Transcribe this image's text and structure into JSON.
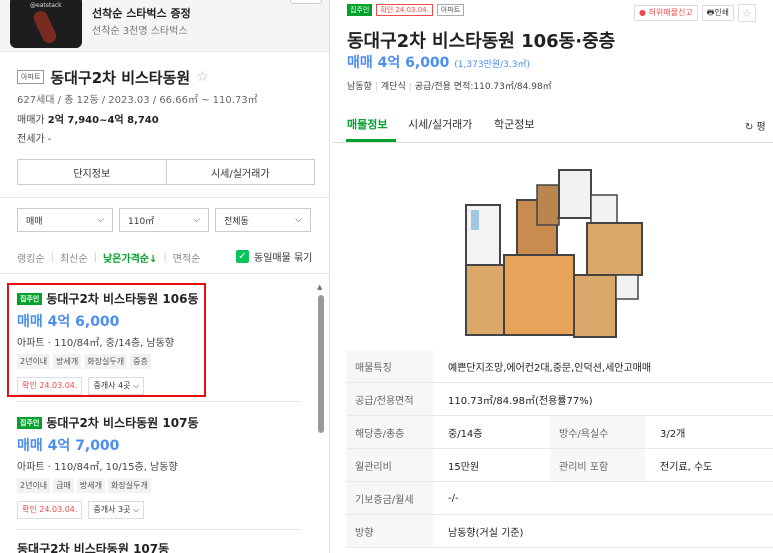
{
  "ad": {
    "thumb_brand": "@eatstack",
    "title": "선착순 스타벅스 증정",
    "subtitle": "선착순 3천명 스타벅스"
  },
  "complex": {
    "type_badge": "아파트",
    "name": "동대구2차 비스타동원",
    "star": "☆",
    "meta": "627세대 / 총 12동 / 2023.03 / 66.66㎡ ~ 110.73㎡",
    "sale_label": "매매가",
    "sale_value": "2억 7,940~4억 8,740",
    "rent_label": "전세가 -",
    "btn_complex_info": "단지정보",
    "btn_market_price": "시세/실거래가"
  },
  "filters": {
    "trade": "매매",
    "size": "110㎡",
    "dong": "전체동"
  },
  "sort": {
    "items": [
      "랭킹순",
      "최신순",
      "낮은가격순↓",
      "면적순"
    ],
    "active_index": 2,
    "same_listing_label": "동일매물 묶기"
  },
  "listings": [
    {
      "tag": "집주인",
      "title": "동대구2차 비스타동원 106동",
      "price": "매매 4억 6,000",
      "info": "아파트 · 110/84㎡, 중/14층, 남동향",
      "chips": [
        "2년이내",
        "방세개",
        "화장실두개",
        "중층"
      ],
      "confirm": "확인 24.03.04.",
      "agent": "중개사 4곳 ⌵"
    },
    {
      "tag": "집주인",
      "title": "동대구2차 비스타동원 107동",
      "price": "매매 4억 7,000",
      "info": "아파트 · 110/84㎡, 10/15층, 남동향",
      "chips": [
        "2년이내",
        "급매",
        "방세개",
        "화장실두개"
      ],
      "confirm": "확인 24.03.04.",
      "agent": "중개사 3곳 ⌵"
    },
    {
      "title": "동대구2차 비스타동원 107동"
    }
  ],
  "detail": {
    "tag_owner": "집주인",
    "tag_confirm": "확인 24.03.04.",
    "tag_type": "아파트",
    "report": "● 허위매물신고",
    "print": "🖶인쇄",
    "star": "☆",
    "title": "동대구2차 비스타동원 106동·중층",
    "price": "매매 4억 6,000",
    "price_unit": "(1,373만원/3.3㎡)",
    "spec": [
      "남동향",
      "계단식",
      "공급/전용 면적:110.73㎡/84.98㎡"
    ],
    "tabs": [
      "매물정보",
      "시세/실거래가",
      "학군정보"
    ],
    "refresh": "↻ 평",
    "table": [
      {
        "k": "매물특징",
        "v": "예쁜단지조망,에어컨2대,중문,인덕션,세안고매매"
      },
      {
        "k": "공급/전용면적",
        "v": "110.73㎡/84.98㎡(전용률77%)"
      },
      {
        "k": "해당층/총층",
        "v": "중/14층",
        "k2": "방수/욕실수",
        "v2": "3/2개"
      },
      {
        "k": "월관리비",
        "v": "15만원",
        "k2": "관리비 포함",
        "v2": "전기료, 수도"
      },
      {
        "k": "기보증금/월세",
        "v": "-/-"
      },
      {
        "k": "방향",
        "v": "남동향(거실 기준)"
      }
    ]
  },
  "colors": {
    "accent_green": "#03a12c",
    "price_blue": "#4b8ef1",
    "highlight_red": "#e50f0f"
  }
}
